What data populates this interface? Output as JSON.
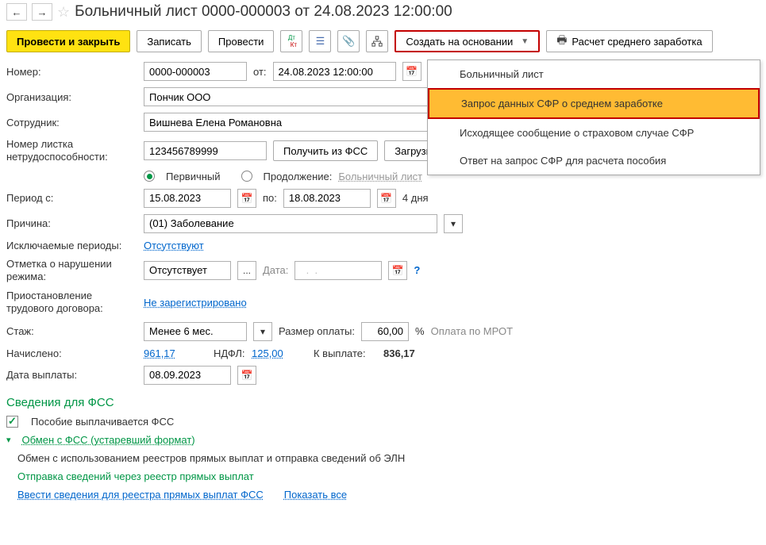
{
  "title": "Больничный лист 0000-000003 от 24.08.2023 12:00:00",
  "toolbar": {
    "submit_close": "Провести и закрыть",
    "save": "Записать",
    "submit": "Провести",
    "create_based": "Создать на основании",
    "avg_salary_calc": "Расчет среднего заработка"
  },
  "dropdown": {
    "item1": "Больничный лист",
    "item2": "Запрос данных СФР о среднем заработке",
    "item3": "Исходящее сообщение о страховом случае СФР",
    "item4": "Ответ на запрос СФР для расчета пособия"
  },
  "fields": {
    "number_label": "Номер:",
    "number_value": "0000-000003",
    "from_label": "от:",
    "from_value": "24.08.2023 12:00:00",
    "org_label": "Организация:",
    "org_value": "Пончик ООО",
    "emp_label": "Сотрудник:",
    "emp_value": "Вишнева Елена Романовна",
    "cert_num_label_l1": "Номер листка",
    "cert_num_label_l2": "нетрудоспособности:",
    "cert_num_value": "123456789999",
    "get_fss": "Получить из ФСС",
    "load_file": "Загрузить и",
    "primary": "Первичный",
    "continuation": "Продолжение:",
    "cont_link": "Больничный лист",
    "period_from_label": "Период с:",
    "period_from_value": "15.08.2023",
    "period_to_label": "по:",
    "period_to_value": "18.08.2023",
    "period_days": "4 дня",
    "reason_label": "Причина:",
    "reason_value": "(01) Заболевание",
    "excl_label": "Исключаемые периоды:",
    "excl_value": "Отсутствуют",
    "violation_label_l1": "Отметка о нарушении",
    "violation_label_l2": "режима:",
    "violation_value": "Отсутствует",
    "violation_date_label": "Дата:",
    "violation_date_value": "  .  .    ",
    "suspension_label_l1": "Приостановление",
    "suspension_label_l2": "трудового договора:",
    "suspension_value": "Не зарегистрировано",
    "seniority_label": "Стаж:",
    "seniority_value": "Менее 6 мес.",
    "pay_rate_label": "Размер оплаты:",
    "pay_rate_value": "60,00",
    "pay_pct": "%",
    "pay_mrot": "Оплата по МРОТ",
    "accrued_label": "Начислено:",
    "accrued_value": "961,17",
    "ndfl_label": "НДФЛ:",
    "ndfl_value": "125,00",
    "to_pay_label": "К выплате:",
    "to_pay_value": "836,17",
    "pay_date_label": "Дата выплаты:",
    "pay_date_value": "08.09.2023"
  },
  "fss": {
    "section_title": "Сведения для ФСС",
    "paid_by_fss": "Пособие выплачивается ФСС",
    "exchange_old": "Обмен с ФСС (устаревший формат)",
    "exchange_desc": "Обмен с использованием реестров прямых выплат и отправка сведений об ЭЛН",
    "send_via": "Отправка сведений через реестр прямых выплат",
    "enter_link": "Ввести сведения для реестра прямых выплат ФСС",
    "show_all": "Показать все"
  }
}
